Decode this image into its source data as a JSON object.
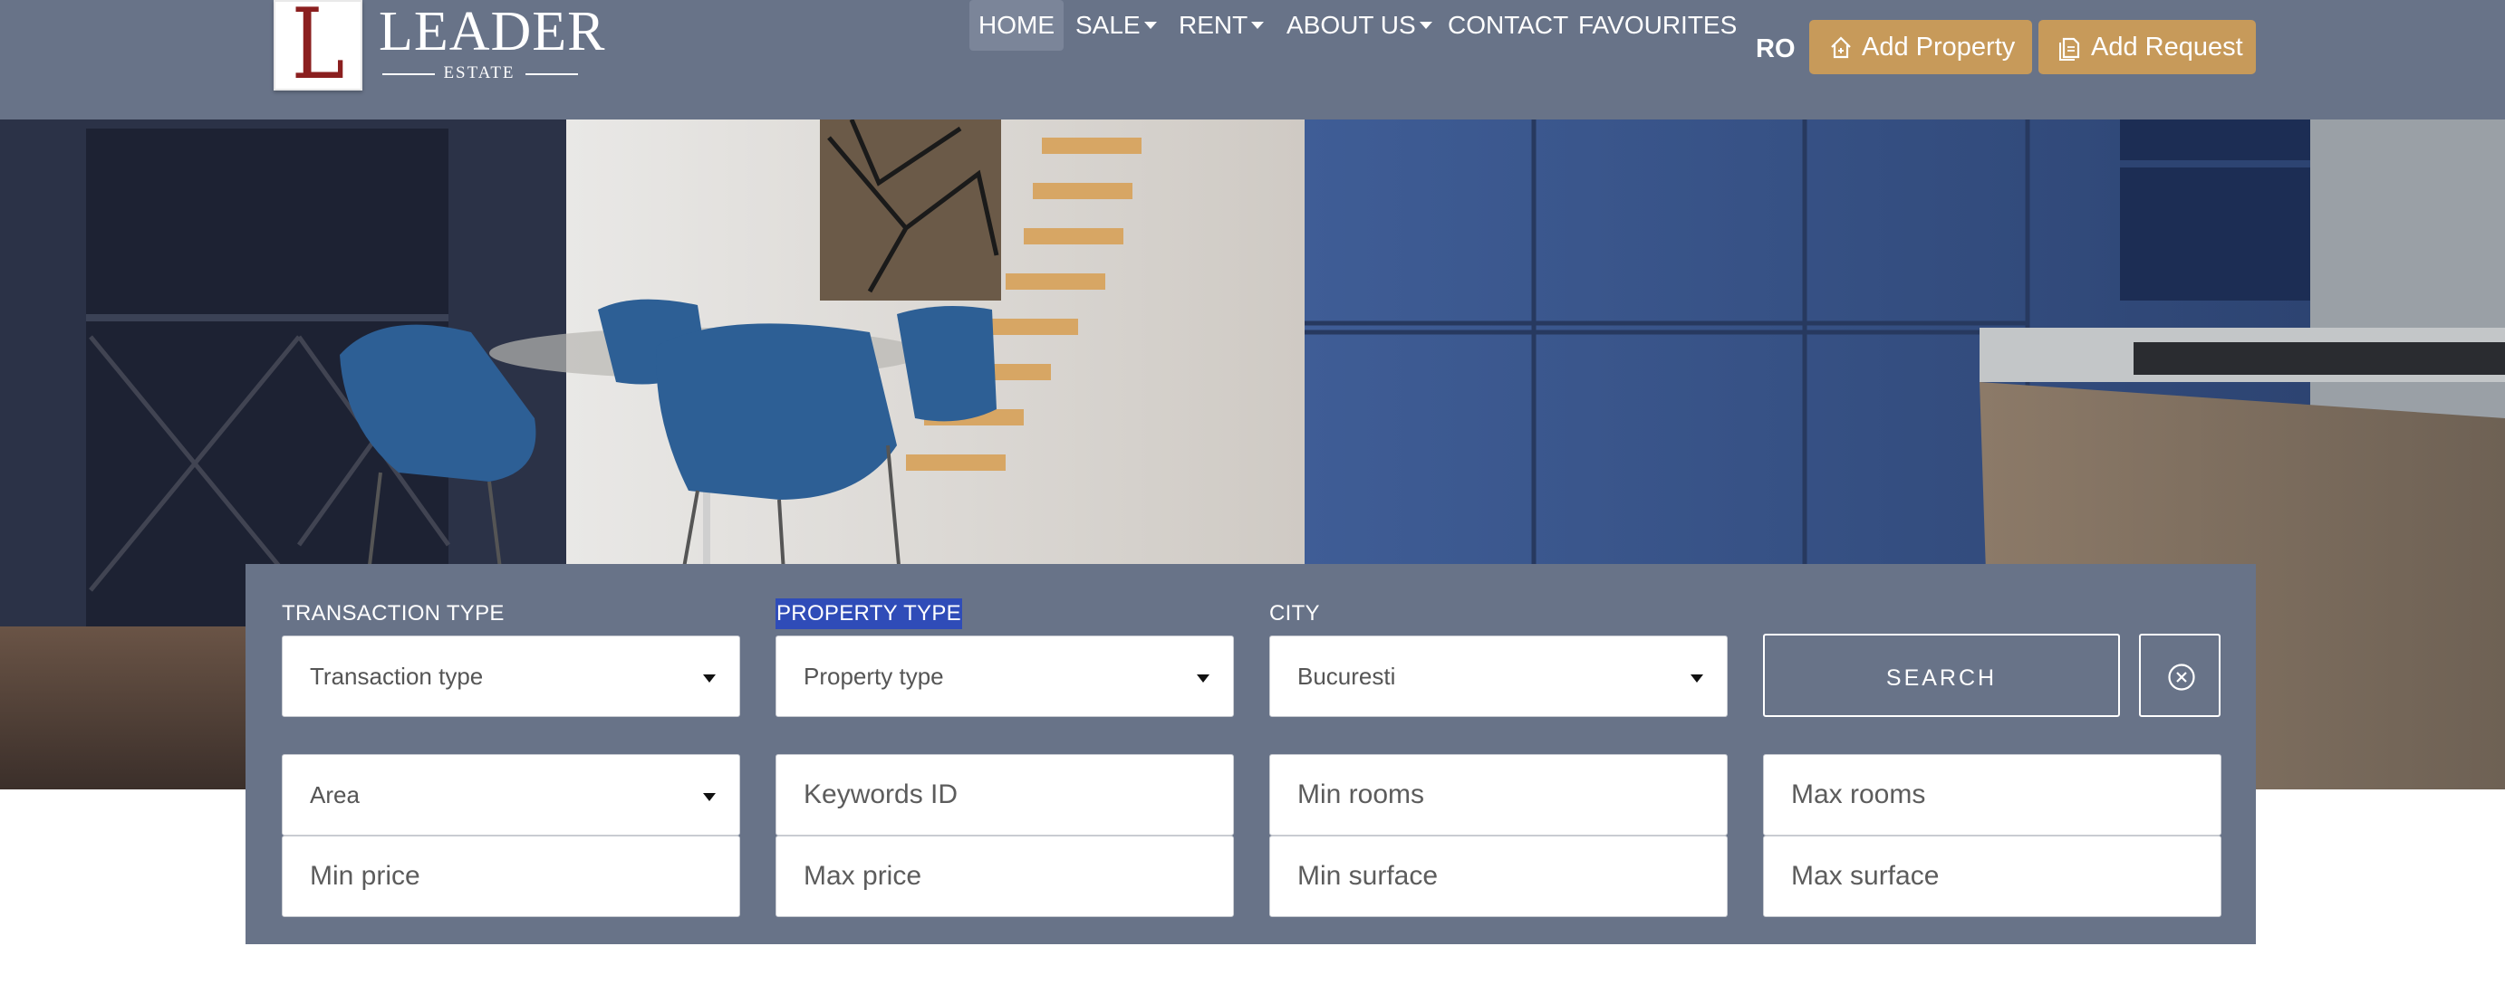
{
  "brand": {
    "mark": "L",
    "name": "LEADER",
    "sub": "ESTATE"
  },
  "nav": {
    "items": [
      {
        "label": "HOME",
        "active": true,
        "dropdown": false
      },
      {
        "label": "SALE",
        "active": false,
        "dropdown": true
      },
      {
        "label": "RENT",
        "active": false,
        "dropdown": true
      },
      {
        "label": "ABOUT US",
        "active": false,
        "dropdown": true
      },
      {
        "label": "CONTACT",
        "active": false,
        "dropdown": false
      },
      {
        "label": "FAVOURITES",
        "active": false,
        "dropdown": false
      }
    ],
    "language": "RO",
    "add_property": "Add Property",
    "add_request": "Add Request"
  },
  "search": {
    "labels": {
      "transaction_type": "TRANSACTION TYPE",
      "property_type": "PROPERTY TYPE",
      "city": "CITY"
    },
    "transaction_type": {
      "value": "Transaction type"
    },
    "property_type": {
      "value": "Property type"
    },
    "city": {
      "value": "Bucuresti"
    },
    "area": {
      "value": "Area"
    },
    "keywords_id": {
      "placeholder": "Keywords ID"
    },
    "min_rooms": {
      "placeholder": "Min rooms"
    },
    "max_rooms": {
      "placeholder": "Max rooms"
    },
    "min_price": {
      "placeholder": "Min price"
    },
    "max_price": {
      "placeholder": "Max price"
    },
    "min_surface": {
      "placeholder": "Min surface"
    },
    "max_surface": {
      "placeholder": "Max surface"
    },
    "search_label": "SEARCH"
  },
  "colors": {
    "header_bg": "#687388",
    "accent_gold": "#c79a5a",
    "selection_blue": "#2f4cb8",
    "logo_red": "#8b1f1f"
  }
}
